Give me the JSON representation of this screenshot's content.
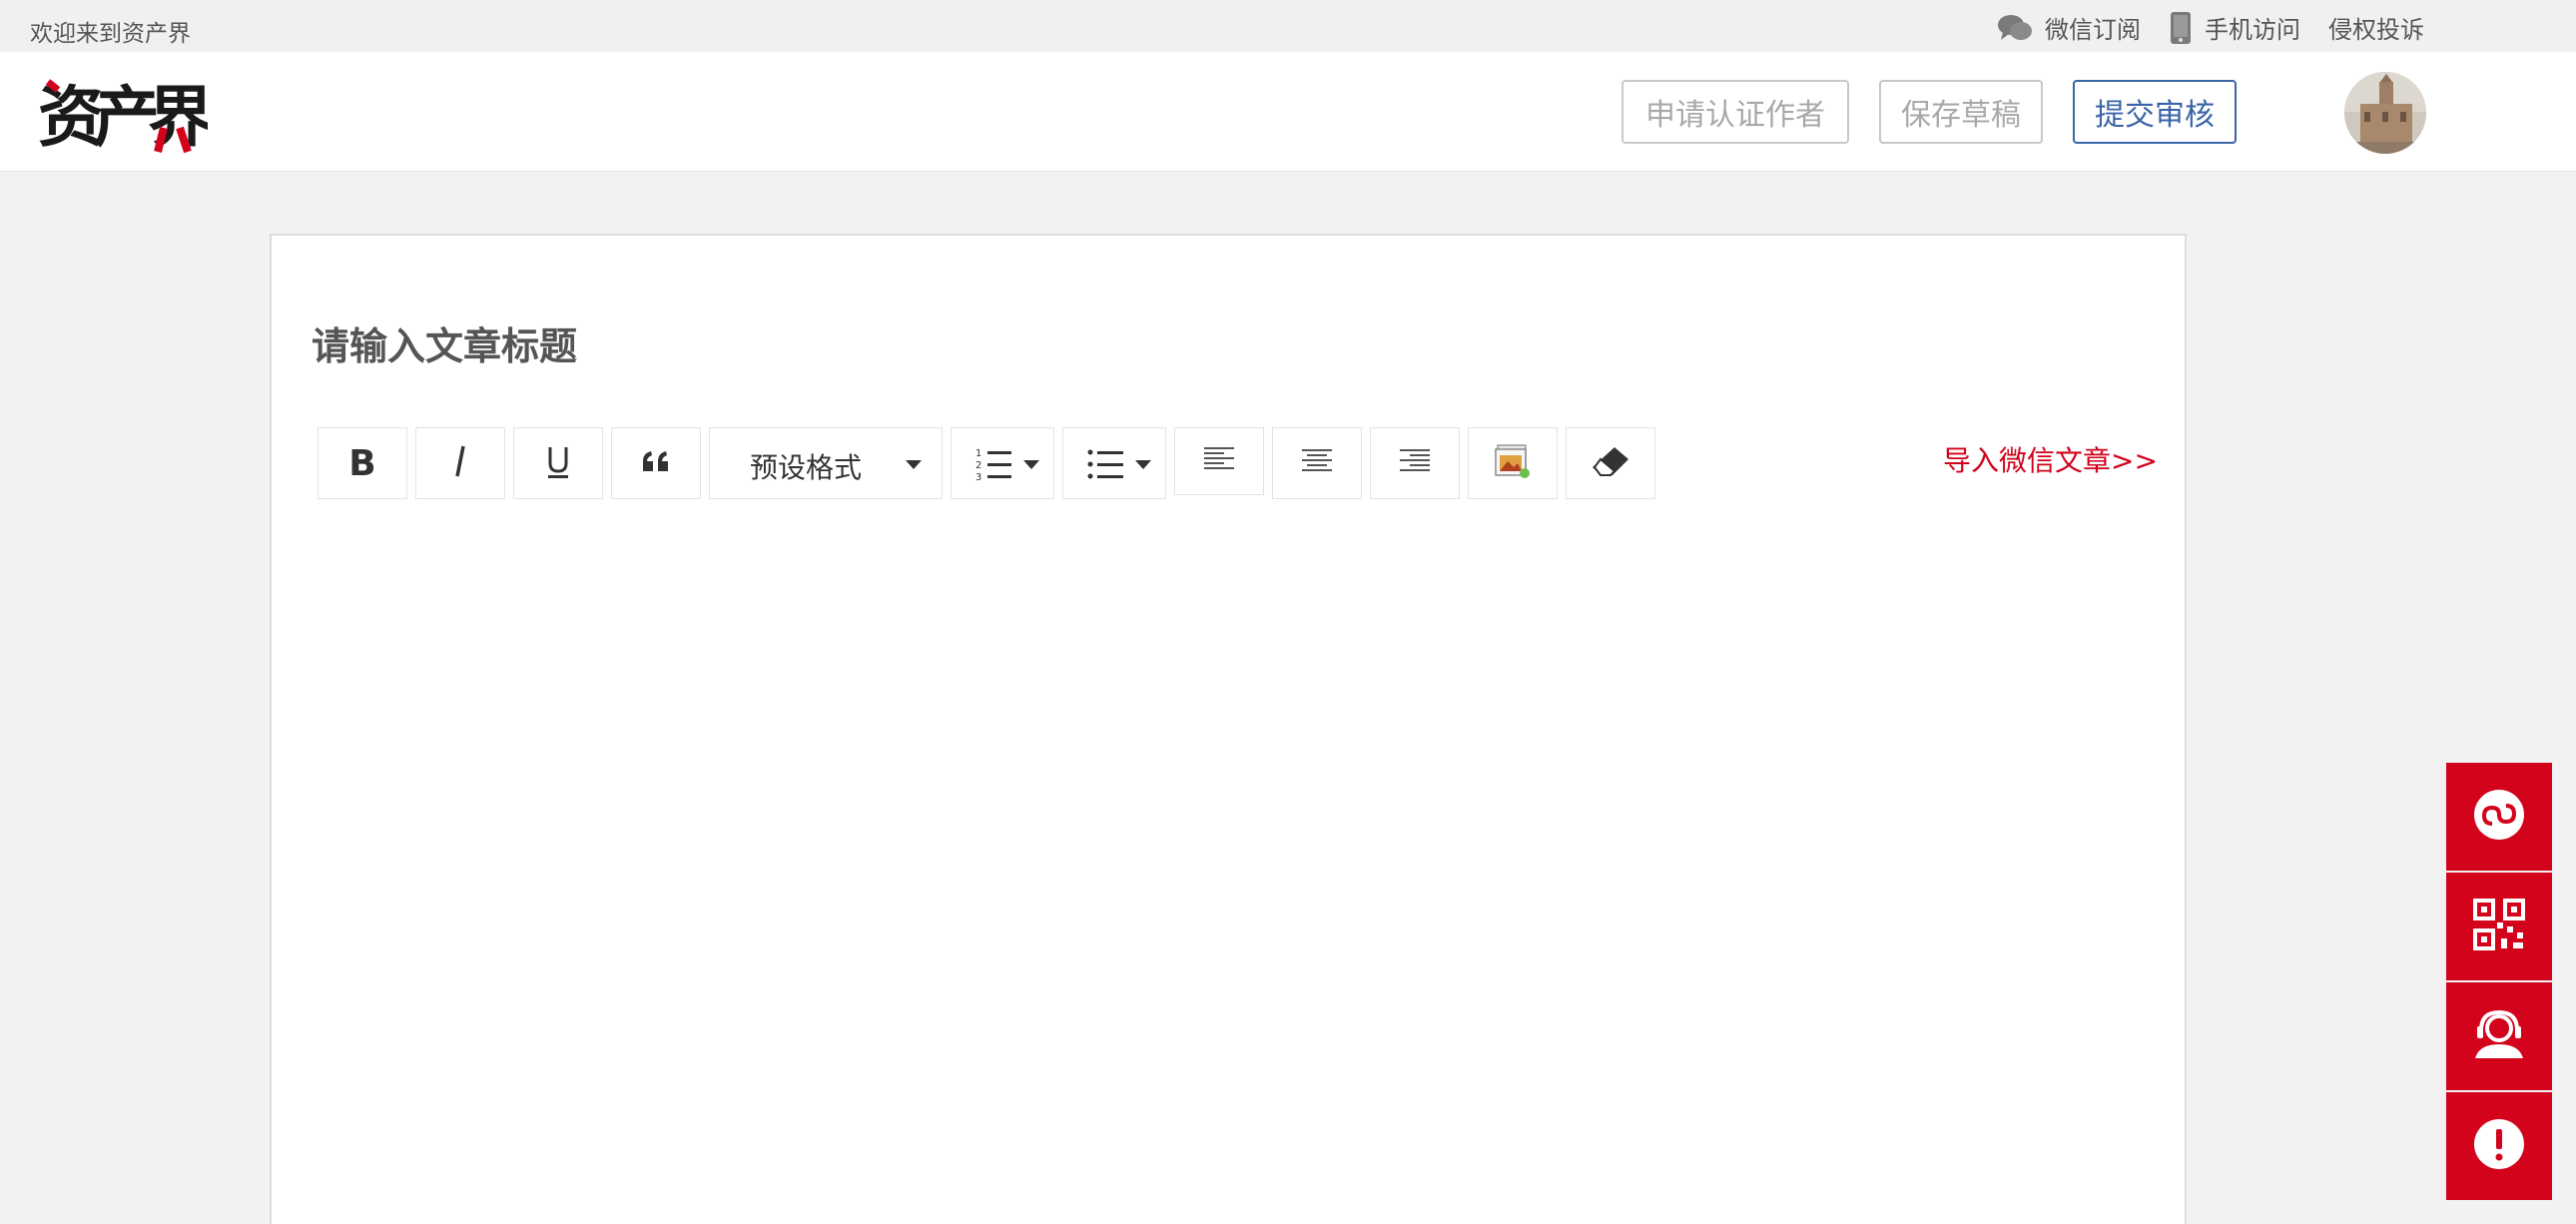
{
  "topbar": {
    "welcome": "欢迎来到资产界",
    "wechat_subscribe": "微信订阅",
    "mobile_access": "手机访问",
    "infringement_complaint": "侵权投诉"
  },
  "header": {
    "logo_text": "资产界",
    "apply_author_label": "申请认证作者",
    "save_draft_label": "保存草稿",
    "submit_review_label": "提交审核"
  },
  "editor": {
    "title_placeholder": "请输入文章标题",
    "format_select_value": "预设格式",
    "import_wechat_label": "导入微信文章>>"
  },
  "toolbar_icons": [
    "bold-icon",
    "italic-icon",
    "underline-icon",
    "quote-icon",
    "ordered-list-icon",
    "unordered-list-icon",
    "align-left-icon",
    "align-center-icon",
    "align-right-icon",
    "image-icon",
    "eraser-icon"
  ],
  "side_buttons": [
    "mini-program-icon",
    "qrcode-icon",
    "customer-service-icon",
    "report-icon"
  ],
  "colors": {
    "brand_red": "#d3031b",
    "primary_blue": "#3a64a7",
    "import_link": "#d0021b"
  }
}
